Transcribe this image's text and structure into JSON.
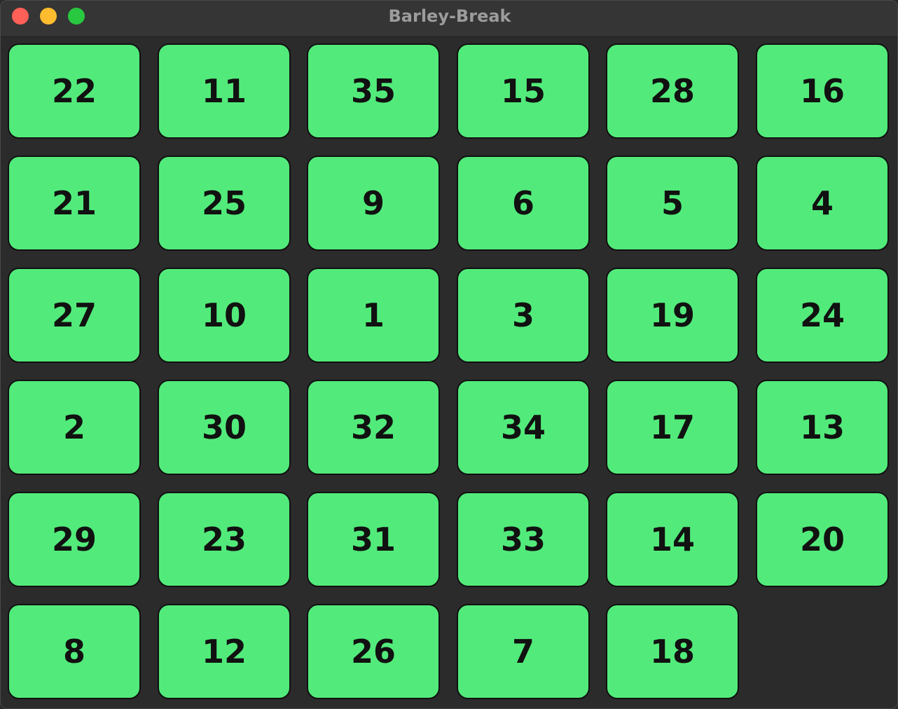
{
  "window": {
    "title": "Barley-Break",
    "traffic_lights": {
      "close_color": "#fe5f57",
      "minimize_color": "#febc2e",
      "zoom_color": "#28c840"
    }
  },
  "board": {
    "rows": 6,
    "cols": 6,
    "tile_color": "#52eb7b",
    "tile_text_color": "#111111",
    "empty_position": {
      "row": 5,
      "col": 5
    },
    "tiles": [
      [
        22,
        11,
        35,
        15,
        28,
        16
      ],
      [
        21,
        25,
        9,
        6,
        5,
        4
      ],
      [
        27,
        10,
        1,
        3,
        19,
        24
      ],
      [
        2,
        30,
        32,
        34,
        17,
        13
      ],
      [
        29,
        23,
        31,
        33,
        14,
        20
      ],
      [
        8,
        12,
        26,
        7,
        18,
        null
      ]
    ]
  }
}
